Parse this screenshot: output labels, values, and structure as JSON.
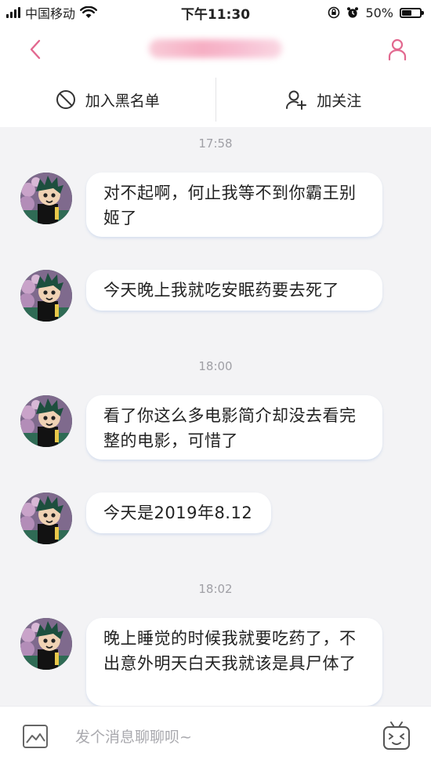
{
  "status_bar": {
    "carrier": "中国移动",
    "time": "下午11:30",
    "battery": "50%",
    "battery_level": 0.5
  },
  "nav": {
    "back_icon": "chevron-left-icon",
    "profile_icon": "user-icon",
    "accent_color": "#e2688f"
  },
  "actions": {
    "blacklist_label": "加入黑名单",
    "blacklist_icon": "block-icon",
    "follow_label": "加关注",
    "follow_icon": "add-user-icon"
  },
  "timestamps": [
    "17:58",
    "18:00",
    "18:02"
  ],
  "messages": [
    {
      "text": "对不起啊，何止我等不到你霸王别姬了"
    },
    {
      "text": "今天晚上我就吃安眠药要去死了"
    },
    {
      "text": "看了你这么多电影简介却没去看完整的电影，可惜了"
    },
    {
      "text": "今天是2019年8.12"
    },
    {
      "text": "晚上睡觉的时候我就要吃药了，不出意外明天白天我就该是具尸体了"
    }
  ],
  "input": {
    "placeholder": "发个消息聊聊呗~",
    "value": "",
    "image_icon": "image-icon",
    "emoji_icon": "emoji-icon"
  }
}
